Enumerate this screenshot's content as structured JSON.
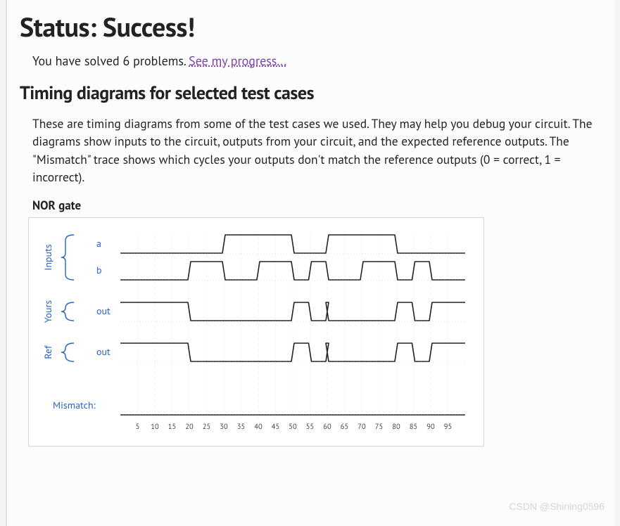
{
  "status_heading": "Status: Success!",
  "solved_prefix": "You have solved ",
  "solved_count": "6",
  "solved_suffix": " problems. ",
  "progress_link": "See my progress...",
  "section_heading": "Timing diagrams for selected test cases",
  "description": "These are timing diagrams from some of the test cases we used. They may help you debug your circuit. The diagrams show inputs to the circuit, outputs from your circuit, and the expected reference outputs. The \"Mismatch\" trace shows which cycles your outputs don't match the reference outputs (0 = correct, 1 = incorrect).",
  "gate_title": "NOR gate",
  "groups": {
    "inputs": "Inputs",
    "yours": "Yours",
    "ref": "Ref"
  },
  "signal_labels": {
    "a": "a",
    "b": "b",
    "out_yours": "out",
    "out_ref": "out",
    "mismatch": "Mismatch:"
  },
  "watermark": "CSDN @Shining0596",
  "chart_data": {
    "type": "timing",
    "x_ticks": [
      5,
      10,
      15,
      20,
      25,
      30,
      35,
      40,
      45,
      50,
      55,
      60,
      65,
      70,
      75,
      80,
      85,
      90,
      95
    ],
    "time_range": [
      0,
      100
    ],
    "signals": [
      {
        "name": "a",
        "group": "Inputs",
        "transitions": [
          [
            0,
            0
          ],
          [
            30,
            1
          ],
          [
            50,
            0
          ],
          [
            60,
            1
          ],
          [
            80,
            0
          ]
        ]
      },
      {
        "name": "b",
        "group": "Inputs",
        "transitions": [
          [
            0,
            0
          ],
          [
            20,
            1
          ],
          [
            30,
            0
          ],
          [
            40,
            1
          ],
          [
            50,
            0
          ],
          [
            55,
            1
          ],
          [
            60,
            0
          ],
          [
            70,
            1
          ],
          [
            80,
            0
          ],
          [
            85,
            1
          ],
          [
            90,
            0
          ]
        ]
      },
      {
        "name": "out",
        "group": "Yours",
        "transitions": [
          [
            0,
            1
          ],
          [
            20,
            0
          ],
          [
            50,
            1
          ],
          [
            55,
            0
          ],
          [
            60,
            1
          ],
          [
            60,
            0
          ],
          [
            80,
            1
          ],
          [
            85,
            0
          ],
          [
            90,
            1
          ]
        ]
      },
      {
        "name": "out",
        "group": "Ref",
        "transitions": [
          [
            0,
            1
          ],
          [
            20,
            0
          ],
          [
            50,
            1
          ],
          [
            55,
            0
          ],
          [
            60,
            1
          ],
          [
            60,
            0
          ],
          [
            80,
            1
          ],
          [
            85,
            0
          ],
          [
            90,
            1
          ]
        ]
      },
      {
        "name": "Mismatch",
        "group": "",
        "transitions": [
          [
            0,
            0
          ]
        ]
      }
    ]
  }
}
